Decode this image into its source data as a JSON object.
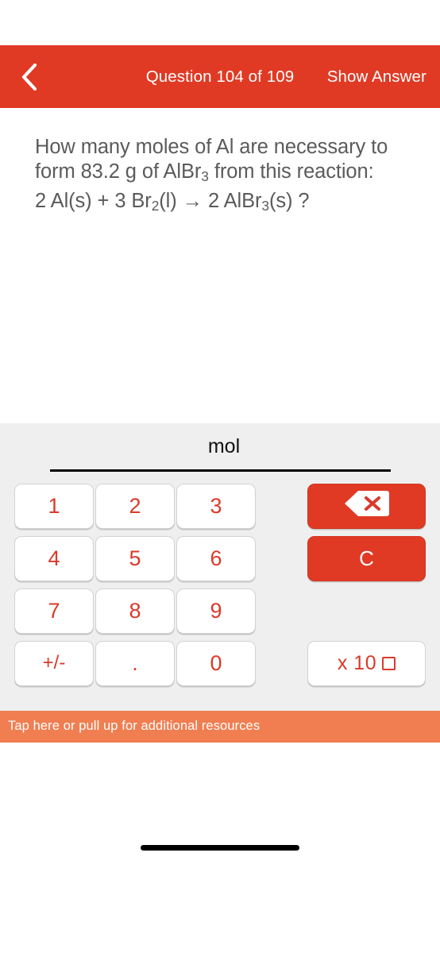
{
  "theme": {
    "header_bg": "#E03A25",
    "accent_red": "#D93A2B",
    "resources_bg": "#F07E51",
    "keypad_bg": "#EFEFEF",
    "question_text": "#5B5B5B"
  },
  "header": {
    "back_icon": "chevron-left-icon",
    "title": "Question 104 of 109",
    "show_answer_label": "Show Answer"
  },
  "question": {
    "line1": "How many moles of Al are necessary to",
    "line2_pre": "form 83.2 g of AlBr",
    "line2_sub": "3",
    "line2_post": " from this reaction:",
    "line3_a": "2 Al(s) + 3 Br",
    "line3_sub1": "2",
    "line3_b": "(l) → 2 AlBr",
    "line3_sub2": "3",
    "line3_c": "(s) ?"
  },
  "answer": {
    "value": "",
    "unit": "mol"
  },
  "keypad": {
    "digits": [
      {
        "label": "1",
        "name": "key-1",
        "style": "num"
      },
      {
        "label": "2",
        "name": "key-2",
        "style": "num"
      },
      {
        "label": "3",
        "name": "key-3",
        "style": "num"
      },
      {
        "label": "4",
        "name": "key-4",
        "style": "num"
      },
      {
        "label": "5",
        "name": "key-5",
        "style": "num"
      },
      {
        "label": "6",
        "name": "key-6",
        "style": "num"
      },
      {
        "label": "7",
        "name": "key-7",
        "style": "num"
      },
      {
        "label": "8",
        "name": "key-8",
        "style": "num"
      },
      {
        "label": "9",
        "name": "key-9",
        "style": "num"
      },
      {
        "label": "+/-",
        "name": "key-plus-minus",
        "style": "sign"
      },
      {
        "label": ".",
        "name": "key-decimal-point",
        "style": "dot"
      },
      {
        "label": "0",
        "name": "key-0",
        "style": "num"
      }
    ],
    "backspace_icon": "backspace-icon",
    "clear_label": "C",
    "exponent_label": "x 10",
    "exponent_placeholder_icon": "empty-square-icon"
  },
  "resources": {
    "label": "Tap here or pull up for additional resources"
  }
}
